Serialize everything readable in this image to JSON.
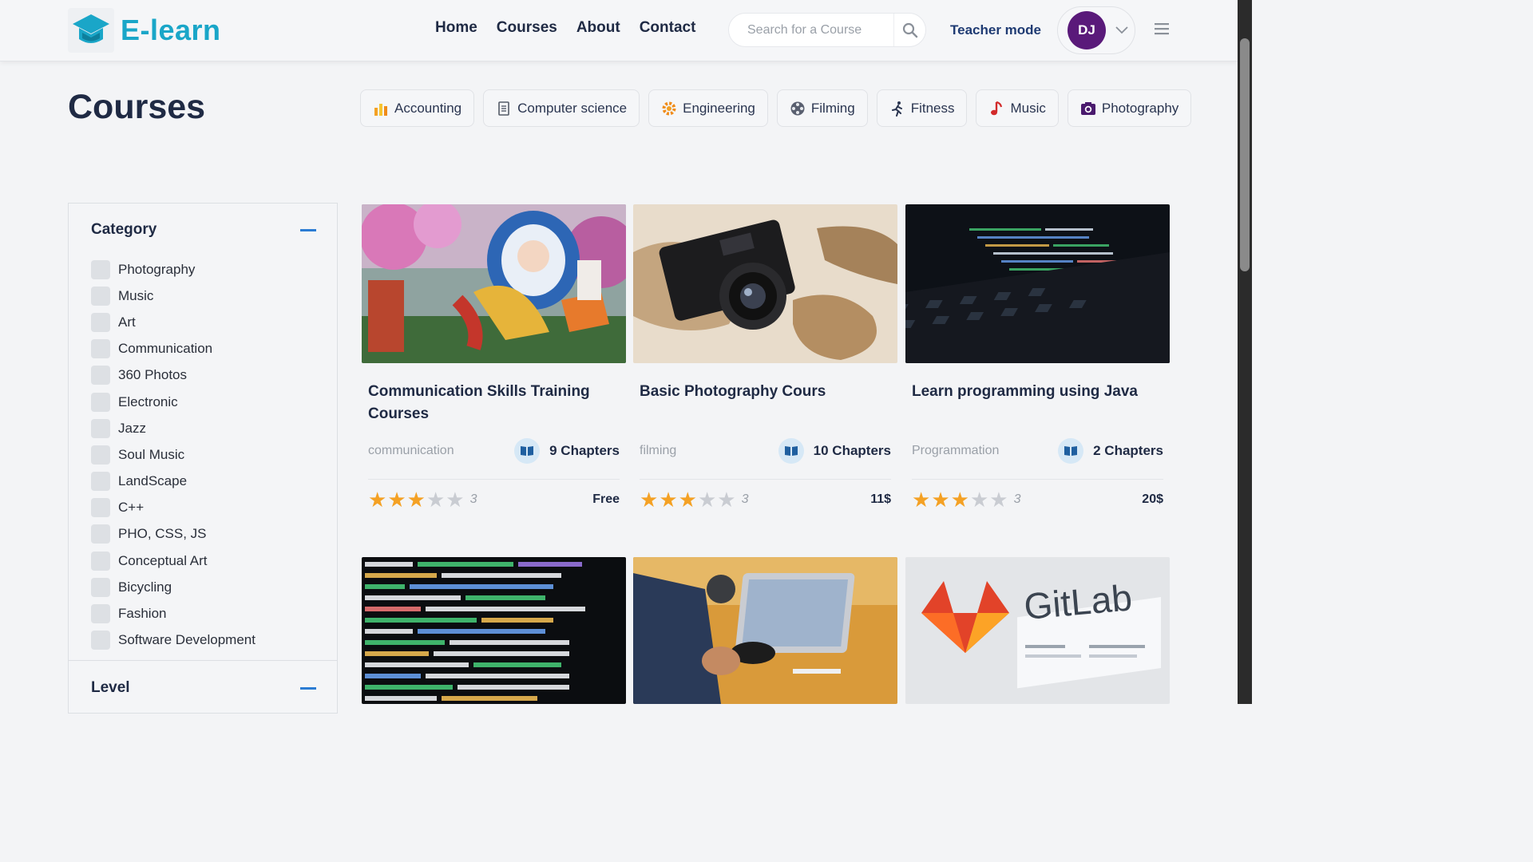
{
  "brand": {
    "name": "E-learn",
    "color": "#1aa6c8"
  },
  "nav": {
    "items": [
      "Home",
      "Courses",
      "About",
      "Contact"
    ]
  },
  "search": {
    "placeholder": "Search for a Course",
    "icon": "search-icon"
  },
  "teacher_mode": "Teacher mode",
  "user": {
    "initials": "DJ",
    "avatar_color": "#5a1a7a"
  },
  "page": {
    "title": "Courses"
  },
  "chips": [
    {
      "label": "Accounting",
      "icon": "bar-chart-icon"
    },
    {
      "label": "Computer science",
      "icon": "document-icon"
    },
    {
      "label": "Engineering",
      "icon": "gear-icon"
    },
    {
      "label": "Filming",
      "icon": "film-reel-icon"
    },
    {
      "label": "Fitness",
      "icon": "running-icon"
    },
    {
      "label": "Music",
      "icon": "music-note-icon"
    },
    {
      "label": "Photography",
      "icon": "camera-icon"
    }
  ],
  "filters": {
    "category_title": "Category",
    "level_title": "Level",
    "categories": [
      "Photography",
      "Music",
      "Art",
      "Communication",
      "360 Photos",
      "Electronic",
      "Jazz",
      "Soul Music",
      "LandScape",
      "C++",
      "PHO, CSS, JS",
      "Conceptual Art",
      "Bicycling",
      "Fashion",
      "Software Development"
    ]
  },
  "courses": [
    {
      "title": "Communication Skills Training Courses",
      "category": "communication",
      "chapters": "9 Chapters",
      "rating": 3,
      "rating_label": "3",
      "price": "Free"
    },
    {
      "title": "Basic Photography Cours",
      "category": "filming",
      "chapters": "10 Chapters",
      "rating": 3,
      "rating_label": "3",
      "price": "11$"
    },
    {
      "title": "Learn programming using Java",
      "category": "Programmation",
      "chapters": "2 Chapters",
      "rating": 3,
      "rating_label": "3",
      "price": "20$"
    }
  ],
  "colors": {
    "accent": "#2b7cd3",
    "star": "#f4a124",
    "text": "#1f2a44"
  }
}
